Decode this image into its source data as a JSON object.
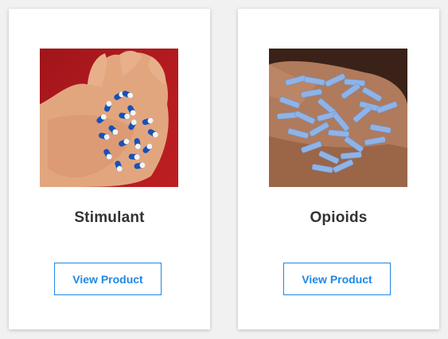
{
  "accent_color": "#1e88e5",
  "products": [
    {
      "name": "Stimulant",
      "button_label": "View Product",
      "image_icon": "stimulant-capsules-image"
    },
    {
      "name": "Opioids",
      "button_label": "View Product",
      "image_icon": "opioid-pills-image"
    }
  ]
}
